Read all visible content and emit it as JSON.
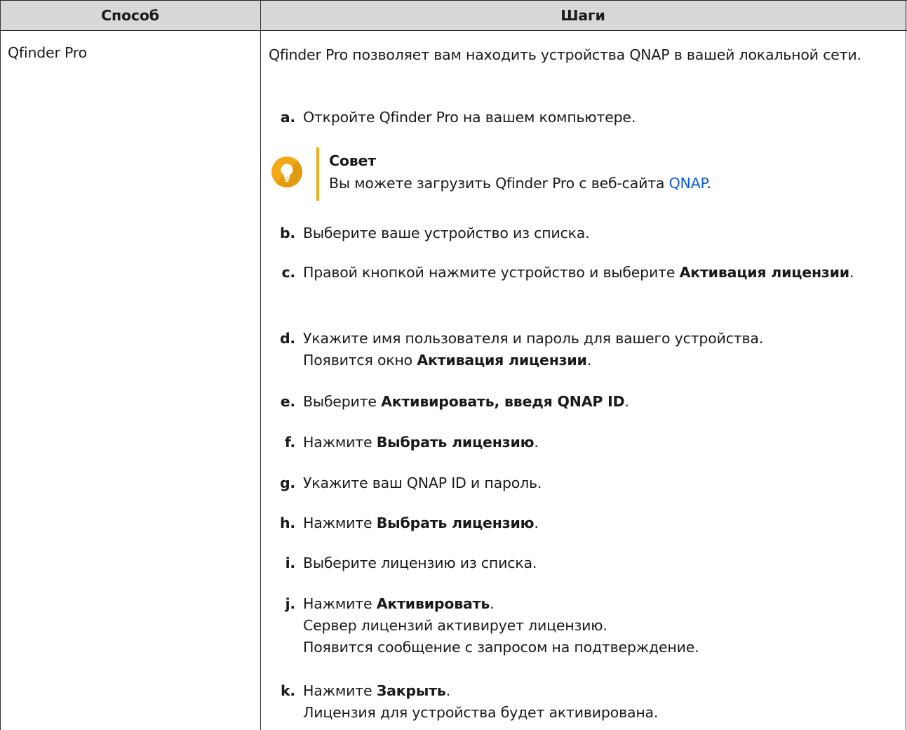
{
  "table": {
    "headers": [
      "Способ",
      "Шаги"
    ],
    "method": "Qfinder Pro",
    "intro": "Qfinder Pro позволяет вам находить устройства QNAP в вашей локальной сети.",
    "tip": {
      "title": "Совет",
      "text_before": "Вы можете загрузить Qfinder Pro с веб-сайта ",
      "link": "QNAP",
      "text_after": ".",
      "icon": "lightbulb-icon",
      "accent": "#f3a917"
    },
    "steps": [
      {
        "letter": "a.",
        "text": "Откройте Qfinder Pro на вашем компьютере."
      },
      {
        "letter": "b.",
        "text": "Выберите ваше устройство из списка."
      },
      {
        "letter": "c.",
        "text_before": "Правой кнопкой нажмите устройство и выберите ",
        "bold": "Активация лицензии",
        "text_after": "."
      },
      {
        "letter": "d.",
        "line1": "Укажите имя пользователя и пароль для вашего устройства.",
        "text_before": "Появится окно ",
        "bold": "Активация лицензии",
        "text_after": "."
      },
      {
        "letter": "e.",
        "text_before": "Выберите ",
        "bold": "Активировать, введя QNAP ID",
        "text_after": "."
      },
      {
        "letter": "f.",
        "text_before": "Нажмите ",
        "bold": "Выбрать лицензию",
        "text_after": "."
      },
      {
        "letter": "g.",
        "text": "Укажите ваш QNAP ID и пароль."
      },
      {
        "letter": "h.",
        "text_before": "Нажмите ",
        "bold": "Выбрать лицензию",
        "text_after": "."
      },
      {
        "letter": "i.",
        "text": "Выберите лицензию из списка."
      },
      {
        "letter": "j.",
        "text_before": "Нажмите ",
        "bold": "Активировать",
        "text_after": ".",
        "line2": "Сервер лицензий активирует лицензию.",
        "line3": "Появится сообщение с запросом на подтверждение."
      },
      {
        "letter": "k.",
        "text_before": "Нажмите ",
        "bold": "Закрыть",
        "text_after": ".",
        "line2": "Лицензия для устройства будет активирована."
      }
    ]
  }
}
